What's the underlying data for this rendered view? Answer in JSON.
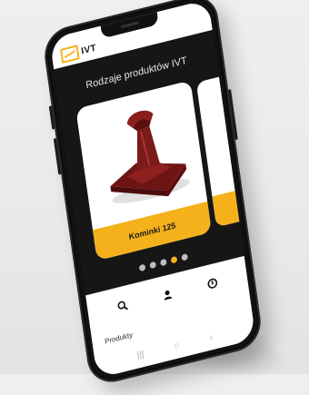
{
  "app": {
    "logo_text": "IVT"
  },
  "main": {
    "heading": "Rodzaje produktów IVT",
    "carousel": {
      "active_index": 3,
      "dot_count": 5,
      "current_item": {
        "label": "Kominki 125"
      }
    }
  },
  "bottom_nav": {
    "items": [
      "search-icon",
      "profile-icon",
      "power-icon"
    ],
    "active_label": "Produkty"
  },
  "system_nav": [
    "recent-apps-icon",
    "home-icon",
    "back-icon"
  ],
  "colors": {
    "accent": "#f4b11b",
    "dark_bg": "#161616",
    "product": "#8b1d1d"
  }
}
